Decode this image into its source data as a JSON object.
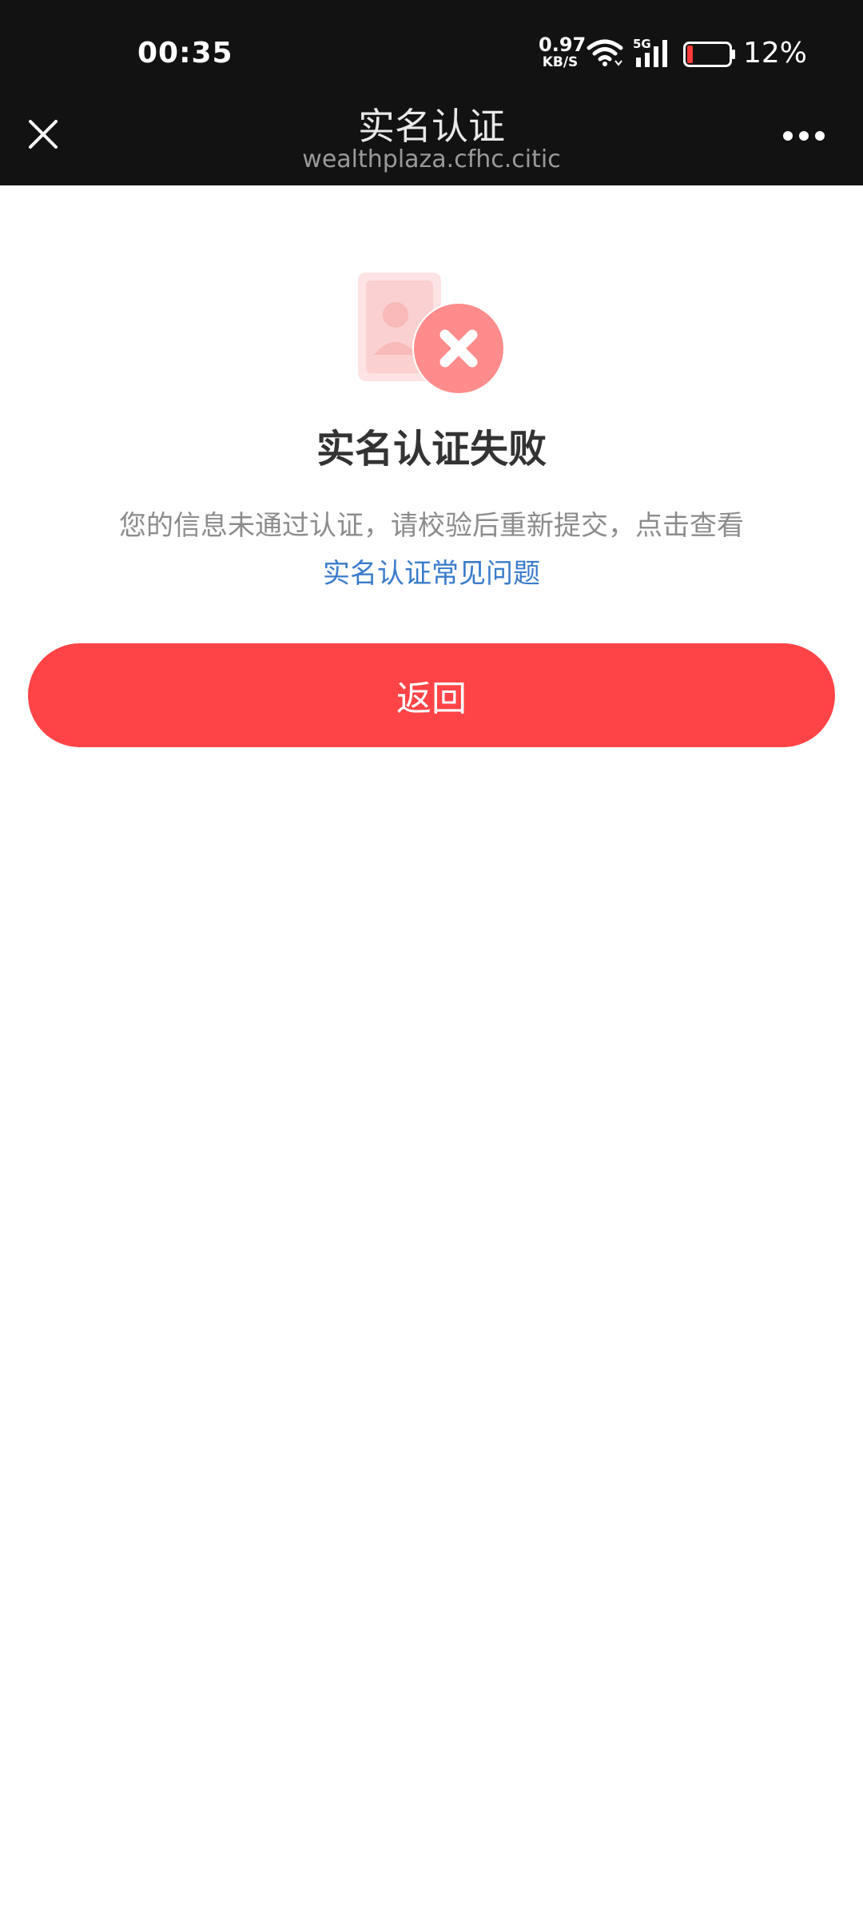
{
  "status_bar": {
    "time": "00:35",
    "net_speed_value": "0.97",
    "net_speed_unit": "KB/S",
    "network_type": "5G",
    "battery_percent": "12%",
    "battery_level": 0.12
  },
  "nav": {
    "title": "实名认证",
    "subtitle": "wealthplaza.cfhc.citic"
  },
  "result": {
    "title": "实名认证失败",
    "description": "您的信息未通过认证，请校验后重新提交，点击查看",
    "faq_link": "实名认证常见问题"
  },
  "actions": {
    "back_label": "返回"
  },
  "colors": {
    "primary": "#ff4447",
    "link": "#3b7ccc",
    "header_bg": "#121212"
  }
}
